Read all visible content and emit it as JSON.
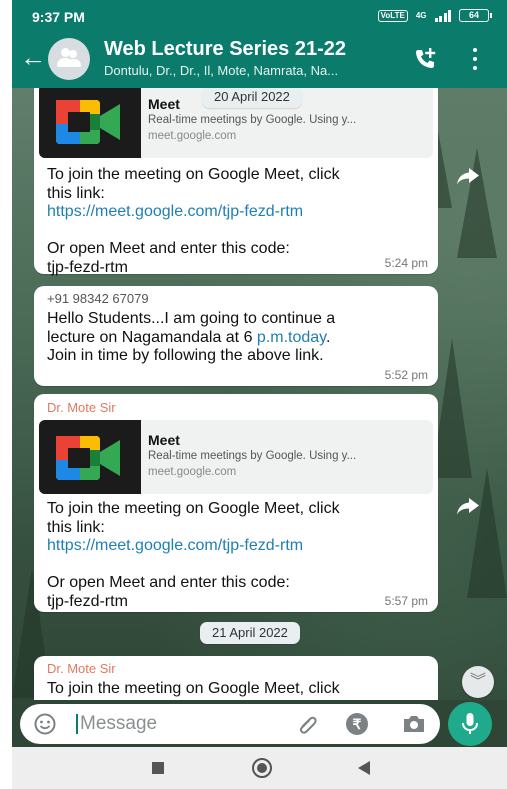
{
  "status_bar": {
    "time": "9:37 PM",
    "volte": "VoLTE",
    "network": "4G",
    "battery": "64"
  },
  "header": {
    "title": "Web Lecture Series 21-22",
    "subtitle": "Dontulu, Dr., Dr., Il, Mote, Namrata, Na..."
  },
  "messages": [
    {
      "date_chip": "20 April 2022",
      "preview": {
        "title": "Meet",
        "description": "Real-time meetings by Google. Using y...",
        "url": "meet.google.com"
      },
      "text_line1": "To join the meeting on Google Meet, click",
      "text_line2": "this link:",
      "link": "https://meet.google.com/tjp-fezd-rtm",
      "code_line1": "Or open Meet and enter this code:",
      "code_line2": "tjp-fezd-rtm",
      "time": "5:24 pm"
    },
    {
      "sender": "+91 98342 67079",
      "line1": "Hello Students...I am going to continue a",
      "line2_pre": "lecture on Nagamandala at 6 ",
      "line2_link": "p.m.today",
      "line2_post": ".",
      "line3": "Join in time by following the above link.",
      "time": "5:52 pm"
    },
    {
      "sender": "Dr. Mote Sir",
      "preview": {
        "title": "Meet",
        "description": "Real-time meetings by Google. Using y...",
        "url": "meet.google.com"
      },
      "text_line1": "To join the meeting on Google Meet, click",
      "text_line2": "this link:",
      "link": "https://meet.google.com/tjp-fezd-rtm",
      "code_line1": "Or open Meet and enter this code:",
      "code_line2": "tjp-fezd-rtm",
      "time": "5:57 pm"
    },
    {
      "date_chip": "21 April 2022",
      "sender": "Dr. Mote Sir",
      "text_line1": "To join the meeting on Google Meet, click"
    }
  ],
  "input": {
    "placeholder": "Message"
  },
  "icons": {
    "back": "back-arrow-icon",
    "add_call": "add-call-icon",
    "menu": "more-vert-icon",
    "forward": "forward-icon",
    "scroll_down": "double-chevron-down-icon",
    "emoji": "emoji-icon",
    "attach": "paperclip-icon",
    "payment": "rupee-icon",
    "camera": "camera-icon",
    "mic": "microphone-icon"
  },
  "colors": {
    "header": "#0b7b6b",
    "link": "#1f7fb5",
    "sender_name": "#e27a5e",
    "mic_button": "#1fab8b"
  }
}
